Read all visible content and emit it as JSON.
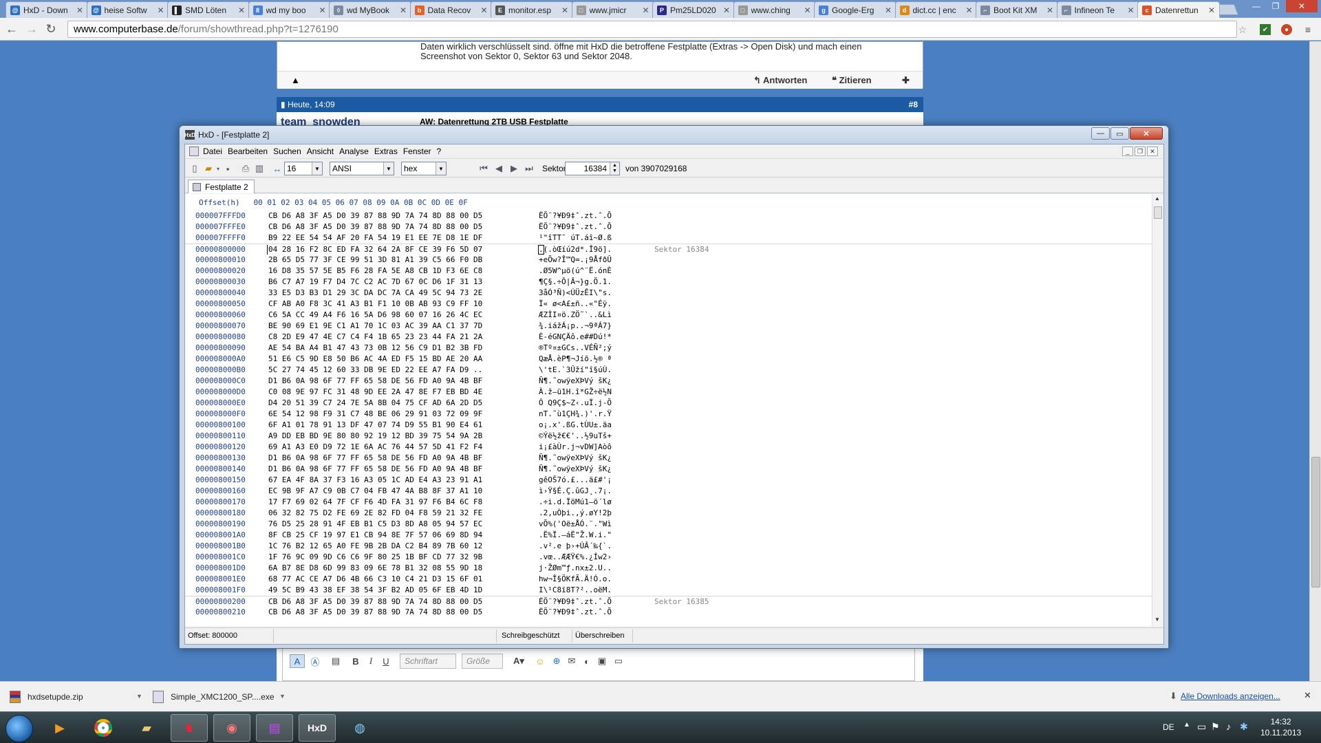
{
  "browser": {
    "tabs": [
      {
        "label": "HxD - Down",
        "fav_color": "#2c6fc2",
        "fav_glyph": "@"
      },
      {
        "label": "heise Softw",
        "fav_color": "#2c6fc2",
        "fav_glyph": "@"
      },
      {
        "label": "SMD Löten",
        "fav_color": "#222222",
        "fav_glyph": "▌"
      },
      {
        "label": "wd my boo",
        "fav_color": "#4a7fd8",
        "fav_glyph": "8"
      },
      {
        "label": "wd MyBook",
        "fav_color": "#7c8aa0",
        "fav_glyph": "◊"
      },
      {
        "label": "Data Recov",
        "fav_color": "#e2622a",
        "fav_glyph": "b"
      },
      {
        "label": "monitor.esp",
        "fav_color": "#555555",
        "fav_glyph": "E"
      },
      {
        "label": "www.jmicr",
        "fav_color": "#999999",
        "fav_glyph": "□"
      },
      {
        "label": "Pm25LD020",
        "fav_color": "#2a2a8a",
        "fav_glyph": "P"
      },
      {
        "label": "www.ching",
        "fav_color": "#999999",
        "fav_glyph": "□"
      },
      {
        "label": "Google-Erg",
        "fav_color": "#4a7fd8",
        "fav_glyph": "g"
      },
      {
        "label": "dict.cc | enc",
        "fav_color": "#d88a1e",
        "fav_glyph": "d"
      },
      {
        "label": "Boot Kit XM",
        "fav_color": "#7c8aa0",
        "fav_glyph": "⌐"
      },
      {
        "label": "Infineon Te",
        "fav_color": "#7c8aa0",
        "fav_glyph": "⌐"
      },
      {
        "label": "Datenrettun",
        "fav_color": "#d8522a",
        "fav_glyph": "c"
      }
    ],
    "url_host": "www.computerbase.de",
    "url_path": "/forum/showthread.php?t=1276190"
  },
  "forum": {
    "post1_text_line1": "Daten wirklich verschlüsselt sind. öffne mit HxD die betroffene Festplatte (Extras -> Open Disk) und mach einen",
    "post1_text_line2": "Screenshot von Sektor 0, Sektor 63 und Sektor 2048.",
    "reply_label": "Antworten",
    "quote_label": "Zitieren",
    "post2_date": "Heute, 14:09",
    "post2_number": "#8",
    "post2_user": "team_snowden",
    "post2_subject": "AW: Datenrettung 2TB USB Festplatte",
    "editor_font_placeholder": "Schriftart",
    "editor_size_placeholder": "Größe"
  },
  "hxd": {
    "window_title": "HxD - [Festplatte 2]",
    "menu": [
      "Datei",
      "Bearbeiten",
      "Suchen",
      "Ansicht",
      "Analyse",
      "Extras",
      "Fenster",
      "?"
    ],
    "bytes_per_row": "16",
    "charset": "ANSI",
    "offset_base": "hex",
    "sector_label": "Sektor",
    "sector_value": "16384",
    "sector_total": "von 3907029168",
    "doc_tab": "Festplatte 2",
    "header": "Offset(h)   00 01 02 03 04 05 06 07 08 09 0A 0B 0C 0D 0E 0F",
    "rows": [
      {
        "off": "000007FFFD0",
        "hex": "CB D6 A8 3F A5 D0 39 87 88 9D 7A 74 8D 88 00 D5",
        "asc": "ËÖ¨?¥Ð9‡ˆ.zt.ˆ.Õ",
        "sec": ""
      },
      {
        "off": "000007FFFE0",
        "hex": "CB D6 A8 3F A5 D0 39 87 88 9D 7A 74 8D 88 00 D5",
        "asc": "ËÖ¨?¥Ð9‡ˆ.zt.ˆ.Õ",
        "sec": ""
      },
      {
        "off": "000007FFFF0",
        "hex": "B9 22 EE 54 54 AF 20 FA 54 19 E1 EE 7E D8 1E DF",
        "asc": "¹\"îTT¯ úT.áî~Ø.ß",
        "sec": ""
      },
      {
        "off": "00000800000",
        "hex": "04 28 16 F2 8C ED FA 32 64 2A 8F CE 39 F6 5D 07",
        "asc": ".(.òŒíú2d*.Î9ö].",
        "sec": "Sektor 16384"
      },
      {
        "off": "00000800010",
        "hex": "2B 65 D5 77 3F CE 99 51 3D 81 A1 39 C5 66 F0 DB",
        "asc": "+eÕw?Î™Q=.¡9ÅfðÛ",
        "sec": ""
      },
      {
        "off": "00000800020",
        "hex": "16 D8 35 57 5E B5 F6 28 FA 5E A8 CB 1D F3 6E C8",
        "asc": ".Ø5W^µö(ú^¨Ë.ónÈ",
        "sec": ""
      },
      {
        "off": "00000800030",
        "hex": "B6 C7 A7 19 F7 D4 7C C2 AC 7D 67 0C D6 1F 31 13",
        "asc": "¶Ç§.÷Ô|Â¬}g.Ö.1.",
        "sec": ""
      },
      {
        "off": "00000800040",
        "hex": "33 E5 D3 B3 D1 29 3C DA DC 7A CA 49 5C 94 73 2E",
        "asc": "3åÓ³Ñ)<ÚÜzÊI\\\"s.",
        "sec": ""
      },
      {
        "off": "00000800050",
        "hex": "CF AB A0 F8 3C 41 A3 B1 F1 10 0B AB 93 C9 FF 10",
        "asc": "Ï« ø<A£±ñ..«\"Éÿ.",
        "sec": ""
      },
      {
        "off": "00000800060",
        "hex": "C6 5A CC 49 A4 F6 16 5A D6 98 60 07 16 26 4C EC",
        "asc": "ÆZÌI¤ö.ZÖ˜`..&Lì",
        "sec": ""
      },
      {
        "off": "00000800070",
        "hex": "BE 90 69 E1 9E C1 A1 70 1C 03 AC 39 AA C1 37 7D",
        "asc": "¾.iážÁ¡p..¬9ªÁ7}",
        "sec": ""
      },
      {
        "off": "00000800080",
        "hex": "C8 2D E9 47 4E C7 C4 F4 1B 65 23 23 44 FA 21 2A",
        "asc": "È-éGNÇÄô.e##Dú!*",
        "sec": ""
      },
      {
        "off": "00000800090",
        "hex": "AE 54 BA A4 B1 47 43 73 0B 12 56 C9 D1 B2 3B FD",
        "asc": "®Tº¤±GCs..VÉÑ²;ý",
        "sec": ""
      },
      {
        "off": "000008000A0",
        "hex": "51 E6 C5 9D E8 50 B6 AC 4A ED F5 15 BD AE 20 AA",
        "asc": "QæÅ.èP¶¬Jíõ.½® ª",
        "sec": ""
      },
      {
        "off": "000008000B0",
        "hex": "5C 27 74 45 12 60 33 DB 9E ED 22 EE A7 FA D9 ..",
        "asc": "\\'tE.`3Ûží\"î§úÙ.",
        "sec": ""
      },
      {
        "off": "000008000C0",
        "hex": "D1 B6 0A 98 6F 77 FF 65 58 DE 56 FD A0 9A 4B BF",
        "asc": "Ñ¶.˜owÿeXÞVý šK¿",
        "sec": ""
      },
      {
        "off": "000008000D0",
        "hex": "C0 08 9E 97 FC 31 48 9D EE 2A 47 8E F7 EB BD 4E",
        "asc": "À.ž—ü1H.î*GŽ÷ë½N",
        "sec": ""
      },
      {
        "off": "000008000E0",
        "hex": "D4 20 51 39 C7 24 7E 5A 8B 04 75 CF AD 6A 2D D5",
        "asc": "Ô Q9Ç$~Z‹.uÏ.j-Õ",
        "sec": ""
      },
      {
        "off": "000008000F0",
        "hex": "6E 54 12 98 F9 31 C7 48 BE 06 29 91 03 72 09 9F",
        "asc": "nT.˜ù1ÇH¾.)'.r.Ÿ",
        "sec": ""
      },
      {
        "off": "00000800100",
        "hex": "6F A1 01 78 91 13 DF 47 07 74 D9 55 B1 90 E4 61",
        "asc": "o¡.x'.ßG.tÙU±.äa",
        "sec": ""
      },
      {
        "off": "00000800110",
        "hex": "A9 DD EB BD 9E 80 80 92 19 12 BD 39 75 54 9A 2B",
        "asc": "©Ýë½ž€€'..½9uTš+",
        "sec": ""
      },
      {
        "off": "00000800120",
        "hex": "69 A1 A3 E0 D9 72 1E 6A AC 76 44 57 5D 41 F2 F4",
        "asc": "i¡£àÙr.j¬vDW]Aòô",
        "sec": ""
      },
      {
        "off": "00000800130",
        "hex": "D1 B6 0A 98 6F 77 FF 65 58 DE 56 FD A0 9A 4B BF",
        "asc": "Ñ¶.˜owÿeXÞVý šK¿",
        "sec": ""
      },
      {
        "off": "00000800140",
        "hex": "D1 B6 0A 98 6F 77 FF 65 58 DE 56 FD A0 9A 4B BF",
        "asc": "Ñ¶.˜owÿeXÞVý šK¿",
        "sec": ""
      },
      {
        "off": "00000800150",
        "hex": "67 EA 4F 8A 37 F3 16 A3 05 1C AD E4 A3 23 91 A1",
        "asc": "gêOŠ7ó.£...ä£#'¡",
        "sec": ""
      },
      {
        "off": "00000800160",
        "hex": "EC 9B 9F A7 C9 0B C7 04 FB 47 4A B8 8F 37 A1 10",
        "asc": "ì›Ÿ§É.Ç.ûGJ¸.7¡.",
        "sec": ""
      },
      {
        "off": "00000800170",
        "hex": "17 F7 69 02 64 7F CF F6 4D FA 31 97 F6 B4 6C F8",
        "asc": ".÷i.d.ÏöMú1—ö´lø",
        "sec": ""
      },
      {
        "off": "00000800180",
        "hex": "06 32 82 75 D2 FE 69 2E 82 FD 04 F8 59 21 32 FE",
        "asc": ".2‚uÒþi.‚ý.øY!2þ",
        "sec": ""
      },
      {
        "off": "00000800190",
        "hex": "76 D5 25 28 91 4F EB B1 C5 D3 8D A8 05 94 57 EC",
        "asc": "vÕ%('Oë±ÅÓ.¨.\"Wì",
        "sec": ""
      },
      {
        "off": "000008001A0",
        "hex": "8F CB 25 CF 19 97 E1 CB 94 8E 7F 57 06 69 8D 94",
        "asc": ".Ë%Ï.—áË\"Ž.W.i.\"",
        "sec": ""
      },
      {
        "off": "000008001B0",
        "hex": "1C 76 B2 12 65 A0 FE 9B 2B DA C2 B4 89 7B 60 12",
        "asc": ".v².e þ›+ÚÂ´‰{`.",
        "sec": ""
      },
      {
        "off": "000008001C0",
        "hex": "1F 76 9C 09 9D C6 C6 9F 80 25 1B BF CD 77 32 9B",
        "asc": ".vœ..ÆÆŸ€%.¿Íw2›",
        "sec": ""
      },
      {
        "off": "000008001D0",
        "hex": "6A B7 8E D8 6D 99 83 09 6E 78 B1 32 08 55 9D 18",
        "asc": "j·ŽØm™ƒ.nx±2.U..",
        "sec": ""
      },
      {
        "off": "000008001E0",
        "hex": "68 77 AC CE A7 D6 4B 66 C3 10 C4 21 D3 15 6F 01",
        "asc": "hw¬Î§ÖKfÃ.Ä!Ó.o.",
        "sec": ""
      },
      {
        "off": "000008001F0",
        "hex": "49 5C B9 43 38 EF 38 54 3F B2 AD 05 6F EB 4D 1D",
        "asc": "I\\¹C8ï8T?²..oëM.",
        "sec": ""
      },
      {
        "off": "00000800200",
        "hex": "CB D6 A8 3F A5 D0 39 87 88 9D 7A 74 8D 88 00 D5",
        "asc": "ËÖ¨?¥Ð9‡ˆ.zt.ˆ.Õ",
        "sec": "Sektor 16385"
      },
      {
        "off": "00000800210",
        "hex": "CB D6 A8 3F A5 D0 39 87 88 9D 7A 74 8D 88 00 D5",
        "asc": "ËÖ¨?¥Ð9‡ˆ.zt.ˆ.Õ",
        "sec": ""
      }
    ],
    "status_offset": "Offset: 800000",
    "status_readonly": "Schreibgeschützt",
    "status_mode": "Überschreiben"
  },
  "downloads": {
    "items": [
      "hxdsetupde.zip",
      "Simple_XMC1200_SP....exe"
    ],
    "all_label": "Alle Downloads anzeigen..."
  },
  "taskbar": {
    "lang": "DE",
    "time": "14:32",
    "date": "10.11.2013"
  }
}
